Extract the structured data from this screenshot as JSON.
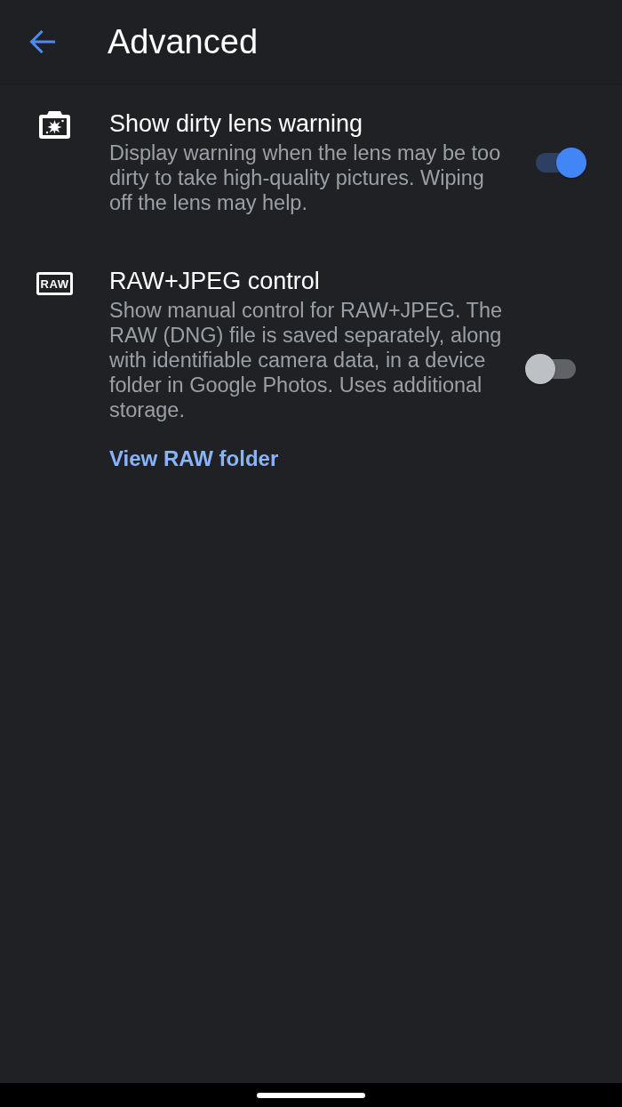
{
  "header": {
    "title": "Advanced"
  },
  "settings": [
    {
      "kind": "toggle",
      "title": "Show dirty lens warning",
      "description": "Display warning when the lens may be too dirty to take high-quality pictures. Wiping off the lens may help.",
      "on": true
    },
    {
      "kind": "toggle",
      "icon_label": "RAW",
      "title": "RAW+JPEG control",
      "description": "Show manual control for RAW+JPEG. The RAW (DNG) file is saved separately, along with identifiable camera data, in a device folder in Google Photos. Uses additional storage.",
      "on": false,
      "link": "View RAW folder"
    }
  ]
}
